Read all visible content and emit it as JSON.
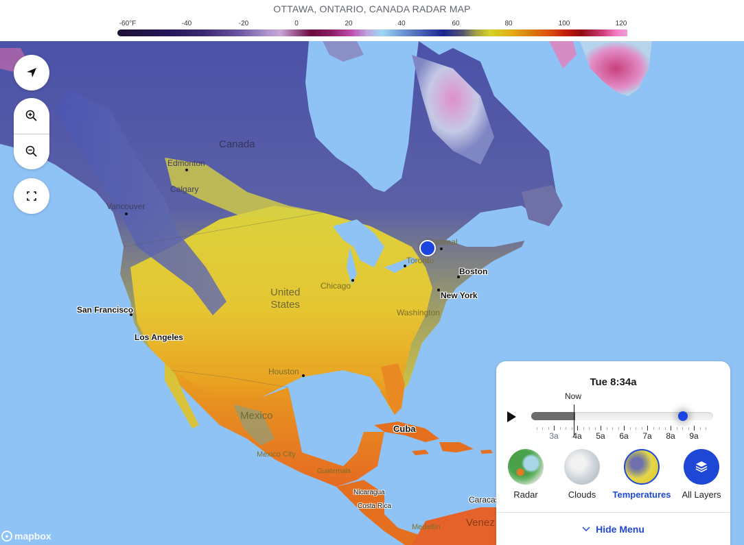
{
  "header": {
    "title": "OTTAWA, ONTARIO, CANADA RADAR MAP",
    "legend": {
      "unit": "°F",
      "ticks": [
        "-60°F",
        "-40",
        "-20",
        "0",
        "20",
        "40",
        "60",
        "80",
        "100",
        "120"
      ],
      "range": [
        -60,
        125
      ]
    }
  },
  "map": {
    "countries": [
      "Canada",
      "United States",
      "Mexico",
      "Cuba"
    ],
    "cities": {
      "edmonton": "Edmonton",
      "calgary": "Calgary",
      "vancouver": "Vancouver",
      "san_francisco": "San Francisco",
      "los_angeles": "Los Angeles",
      "chicago": "Chicago",
      "houston": "Houston",
      "montreal": "Montreal",
      "toronto": "Toronto",
      "boston": "Boston",
      "new_york": "New York",
      "washington": "Washington",
      "mexico_city": "Mexico City",
      "guatemala": "Guatemala",
      "nicaragua": "Nicaragua",
      "costa_rica": "Costa Rica",
      "caracas": "Caracas",
      "medellin": "Medellín",
      "venezuela": "Venez"
    },
    "selected_location": "Ottawa, Ontario, Canada",
    "attribution": "mapbox"
  },
  "controls": {
    "locate": "locate-me",
    "zoom_in": "zoom-in",
    "zoom_out": "zoom-out",
    "fullscreen": "fullscreen"
  },
  "panel": {
    "current_time": "Tue 8:34a",
    "now_label": "Now",
    "hours": [
      "3a",
      "4a",
      "5a",
      "6a",
      "7a",
      "8a",
      "9a"
    ],
    "timeline_position_fraction": 0.835,
    "now_position_fraction": 0.24,
    "layers": [
      {
        "label": "Radar",
        "active": false
      },
      {
        "label": "Clouds",
        "active": false
      },
      {
        "label": "Temperatures",
        "active": true
      },
      {
        "label": "All Layers",
        "active": false
      }
    ],
    "hide_menu_label": "Hide Menu",
    "accent_color": "#1f47d6"
  }
}
